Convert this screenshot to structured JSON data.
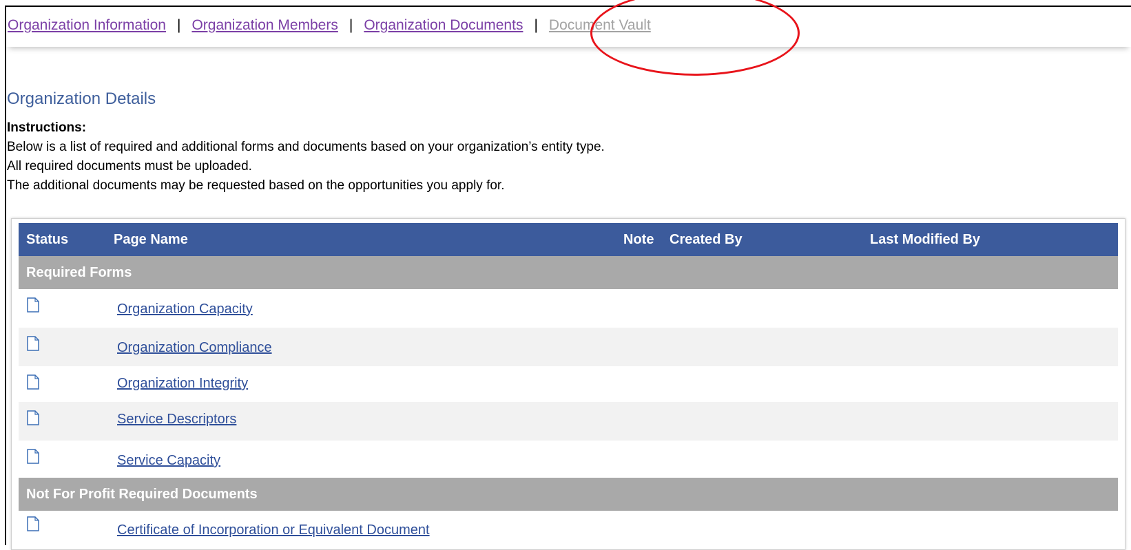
{
  "nav": {
    "links": [
      {
        "label": "Organization Information"
      },
      {
        "label": "Organization Members"
      },
      {
        "label": "Organization Documents"
      },
      {
        "label": "Document Vault"
      }
    ],
    "separator": "|"
  },
  "page": {
    "title": "Organization Details",
    "instructions_label": "Instructions:",
    "instructions": [
      "Below is a list of required and additional forms and documents based on your organization’s entity type.",
      "All required documents must be uploaded.",
      "The additional documents may be requested based on the opportunities you apply for."
    ]
  },
  "table": {
    "columns": {
      "status": "Status",
      "page_name": "Page Name",
      "note": "Note",
      "created_by": "Created By",
      "last_modified_by": "Last Modified By"
    },
    "groups": [
      {
        "title": "Required Forms",
        "rows": [
          {
            "name": "Organization Capacity",
            "icon": "document-icon"
          },
          {
            "name": "Organization Compliance",
            "icon": "document-icon"
          },
          {
            "name": "Organization Integrity",
            "icon": "document-icon"
          },
          {
            "name": "Service Descriptors",
            "icon": "document-icon"
          },
          {
            "name": "Service Capacity",
            "icon": "document-icon"
          }
        ]
      },
      {
        "title": "Not For Profit Required Documents",
        "rows": [
          {
            "name": "Certificate of Incorporation or Equivalent Document",
            "icon": "document-icon"
          }
        ]
      }
    ]
  },
  "colors": {
    "header_bg": "#3c5b9c",
    "group_bg": "#a9a9a9",
    "link": "#2f4f9a",
    "nav_link": "#7b3fa6",
    "highlight": "#e8141b"
  }
}
